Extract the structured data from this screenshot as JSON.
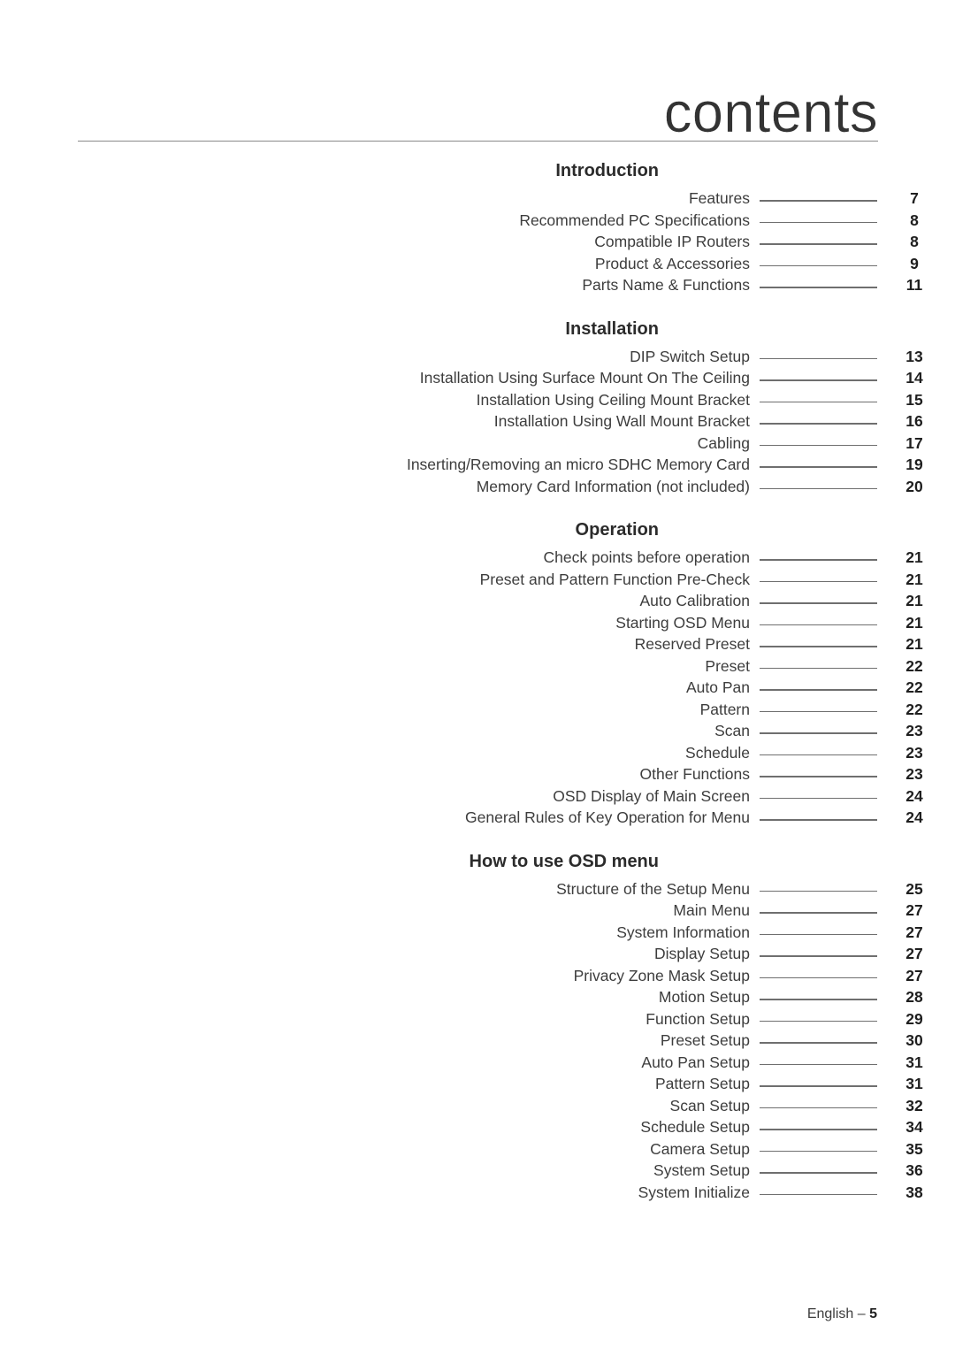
{
  "header": {
    "title": "contents"
  },
  "footer": {
    "language": "English –",
    "page_number": "5"
  },
  "colors": {
    "text": "#3d3d3d",
    "heading": "#2b2b2b",
    "page_number": "#1f1f1f",
    "rule": "#8a8a8a",
    "leader": "#6f6f6f",
    "background": "#ffffff"
  },
  "toc": {
    "sections": [
      {
        "heading": "Introduction",
        "entries": [
          {
            "title": "Features",
            "page": "7"
          },
          {
            "title": "Recommended PC Specifications",
            "page": "8"
          },
          {
            "title": "Compatible IP Routers",
            "page": "8"
          },
          {
            "title": "Product & Accessories",
            "page": "9"
          },
          {
            "title": "Parts Name & Functions",
            "page": "11"
          }
        ]
      },
      {
        "heading": "Installation",
        "entries": [
          {
            "title": "DIP Switch Setup",
            "page": "13"
          },
          {
            "title": "Installation Using Surface Mount On The Ceiling",
            "page": "14"
          },
          {
            "title": "Installation Using Ceiling Mount Bracket",
            "page": "15"
          },
          {
            "title": "Installation Using Wall Mount Bracket",
            "page": "16"
          },
          {
            "title": "Cabling",
            "page": "17"
          },
          {
            "title": "Inserting/Removing an micro SDHC Memory Card",
            "page": "19"
          },
          {
            "title": "Memory Card Information (not included)",
            "page": "20"
          }
        ]
      },
      {
        "heading": "Operation",
        "entries": [
          {
            "title": "Check points before operation",
            "page": "21"
          },
          {
            "title": "Preset and Pattern Function Pre-Check",
            "page": "21"
          },
          {
            "title": "Auto Calibration",
            "page": "21"
          },
          {
            "title": "Starting OSD Menu",
            "page": "21"
          },
          {
            "title": "Reserved Preset",
            "page": "21"
          },
          {
            "title": "Preset",
            "page": "22"
          },
          {
            "title": "Auto Pan",
            "page": "22"
          },
          {
            "title": "Pattern",
            "page": "22"
          },
          {
            "title": "Scan",
            "page": "23"
          },
          {
            "title": "Schedule",
            "page": "23"
          },
          {
            "title": "Other Functions",
            "page": "23"
          },
          {
            "title": "OSD Display of Main Screen",
            "page": "24"
          },
          {
            "title": "General Rules of Key Operation for Menu",
            "page": "24"
          }
        ]
      },
      {
        "heading": "How to use OSD menu",
        "entries": [
          {
            "title": "Structure of the Setup Menu",
            "page": "25"
          },
          {
            "title": "Main Menu",
            "page": "27"
          },
          {
            "title": "System Information",
            "page": "27"
          },
          {
            "title": "Display Setup",
            "page": "27"
          },
          {
            "title": "Privacy Zone Mask Setup",
            "page": "27"
          },
          {
            "title": "Motion Setup",
            "page": "28"
          },
          {
            "title": "Function Setup",
            "page": "29"
          },
          {
            "title": "Preset Setup",
            "page": "30"
          },
          {
            "title": "Auto Pan Setup",
            "page": "31"
          },
          {
            "title": "Pattern Setup",
            "page": "31"
          },
          {
            "title": "Scan Setup",
            "page": "32"
          },
          {
            "title": "Schedule Setup",
            "page": "34"
          },
          {
            "title": "Camera Setup",
            "page": "35"
          },
          {
            "title": "System Setup",
            "page": "36"
          },
          {
            "title": "System Initialize",
            "page": "38"
          }
        ]
      }
    ]
  }
}
